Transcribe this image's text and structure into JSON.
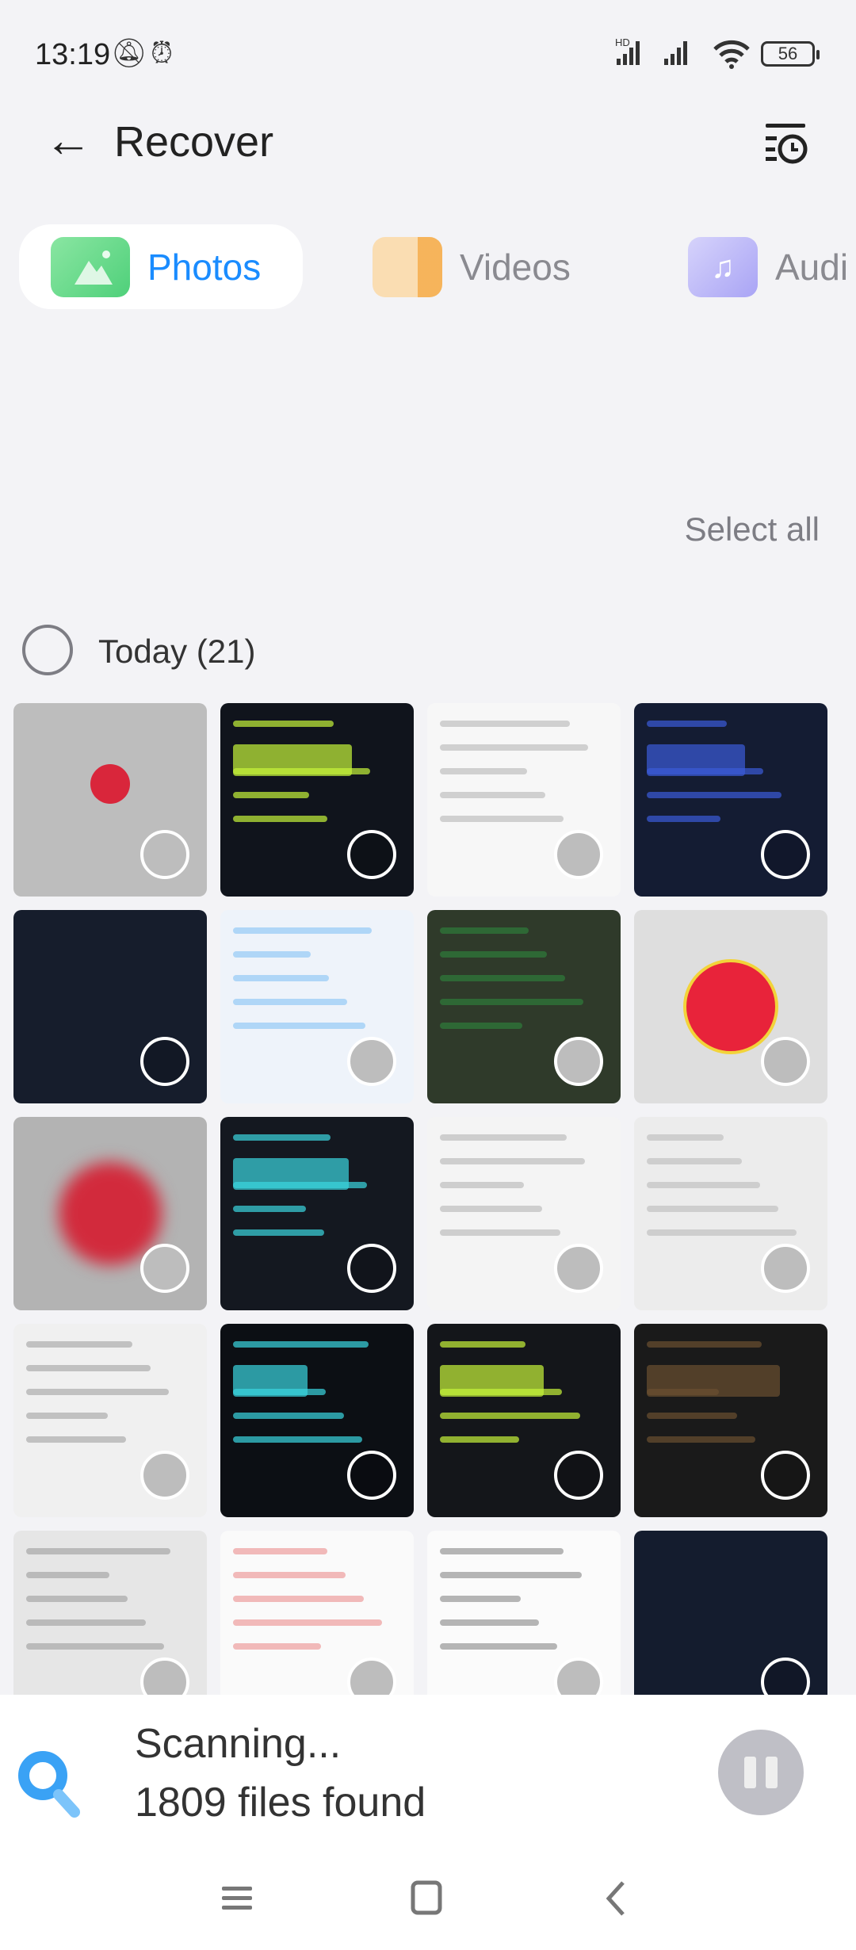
{
  "status_bar": {
    "time": "13:19",
    "battery": "56",
    "icons": [
      "bell-off-icon",
      "alarm-icon",
      "signal-hd-icon",
      "signal-icon",
      "wifi-icon",
      "battery-icon"
    ]
  },
  "header": {
    "title": "Recover",
    "back_icon": "arrow-left-icon",
    "history_icon": "list-clock-icon"
  },
  "tabs": [
    {
      "label": "Photos",
      "active": true,
      "color": "#1a8cff",
      "icon_color": "#5ed47e"
    },
    {
      "label": "Videos",
      "active": false,
      "icon_color": "#f7b55a"
    },
    {
      "label": "Audi",
      "active": false,
      "icon_color": "#a9a4f5"
    }
  ],
  "select_all": "Select all",
  "group": {
    "label": "Today (21)"
  },
  "thumbnails": [
    {
      "bg": "#bdbdbd",
      "tone": "light",
      "accent": "#d9263b"
    },
    {
      "bg": "#10141c",
      "tone": "dark",
      "accent": "#c6f33a"
    },
    {
      "bg": "#f7f7f7",
      "tone": "light",
      "accent": "#888"
    },
    {
      "bg": "#141c33",
      "tone": "dark",
      "accent": "#3a5bd8"
    },
    {
      "bg": "#161d2c",
      "tone": "dark",
      "accent": ""
    },
    {
      "bg": "#eef3fa",
      "tone": "light",
      "accent": "#3aa0f0"
    },
    {
      "bg": "#2f3a2a",
      "tone": "light",
      "accent": "#2fbf4a"
    },
    {
      "bg": "#dedede",
      "tone": "light",
      "accent": "#e8233a"
    },
    {
      "bg": "#b3b3b3",
      "tone": "light",
      "accent": "#d22a3c"
    },
    {
      "bg": "#141820",
      "tone": "dark",
      "accent": "#3ad6e0"
    },
    {
      "bg": "#f4f4f4",
      "tone": "light",
      "accent": "#888"
    },
    {
      "bg": "#ececec",
      "tone": "light",
      "accent": "#999"
    },
    {
      "bg": "#f0f0f0",
      "tone": "light",
      "accent": "#6b6b6b"
    },
    {
      "bg": "#0c0f14",
      "tone": "dark",
      "accent": "#3ad6e0"
    },
    {
      "bg": "#14161a",
      "tone": "dark",
      "accent": "#c6f33a"
    },
    {
      "bg": "#1a1a1a",
      "tone": "dark",
      "accent": "#6b5030"
    },
    {
      "bg": "#e6e6e6",
      "tone": "light",
      "accent": "#666"
    },
    {
      "bg": "#fafafa",
      "tone": "light",
      "accent": "#e04040"
    },
    {
      "bg": "#fbfbfb",
      "tone": "light",
      "accent": "#333"
    },
    {
      "bg": "#141c2e",
      "tone": "dark",
      "accent": ""
    }
  ],
  "scan": {
    "status": "Scanning...",
    "found": "1809 files found",
    "icon": "search-icon",
    "pause_icon": "pause-icon",
    "icon_color": "#2e9bf5"
  },
  "navbar": {
    "menu_icon": "menu-icon",
    "home_icon": "home-square-icon",
    "back_icon": "chevron-left-icon"
  }
}
